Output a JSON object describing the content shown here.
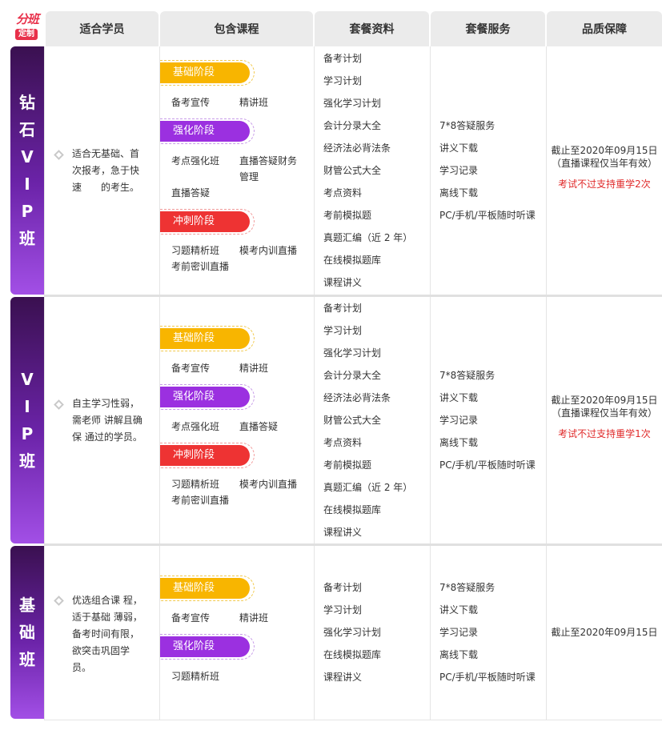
{
  "logo": {
    "top": "分班",
    "box": "定制"
  },
  "headers": [
    "适合学员",
    "包含课程",
    "套餐资料",
    "套餐服务",
    "品质保障"
  ],
  "stages": {
    "basic": "基础阶段",
    "strengthen": "强化阶段",
    "sprint": "冲刺阶段"
  },
  "rows": [
    {
      "label": [
        "钻",
        "石",
        "V",
        "I",
        "P",
        "班"
      ],
      "suitable": [
        "适合无基础、首",
        "次报考，急于快",
        "速　　的考生。"
      ],
      "courses": {
        "basic": [
          "备考宣传",
          "精讲班"
        ],
        "strengthen": [
          "考点强化班",
          "直播答疑财务",
          "管理",
          "直播答疑"
        ],
        "sprint": [
          "习题精析班",
          "模考内训直播",
          "考前密训直播"
        ]
      },
      "materials": [
        "备考计划",
        "学习计划",
        "强化学习计划",
        "会计分录大全",
        "经济法必背法条",
        "财管公式大全",
        "考点资料",
        "考前模拟题",
        "真题汇编（近 2 年）",
        "在线模拟题库",
        "课程讲义"
      ],
      "services": [
        "7*8答疑服务",
        "讲义下载",
        "学习记录",
        "离线下载",
        "PC/手机/平板随时听课"
      ],
      "quality": {
        "line1": "截止至2020年09月15日",
        "line2": "（直播课程仅当年有效）",
        "note": "考试不过支持重学2次"
      }
    },
    {
      "label": [
        "V",
        "I",
        "P",
        "班"
      ],
      "suitable": [
        "自主学习性弱，",
        "需老师 讲解且确",
        "保 通过的学员。"
      ],
      "courses": {
        "basic": [
          "备考宣传",
          "精讲班"
        ],
        "strengthen": [
          "考点强化班",
          "直播答疑"
        ],
        "sprint": [
          "习题精析班",
          "模考内训直播",
          "考前密训直播"
        ]
      },
      "materials": [
        "备考计划",
        "学习计划",
        "强化学习计划",
        "会计分录大全",
        "经济法必背法条",
        "财管公式大全",
        "考点资料",
        "考前模拟题",
        "真题汇编（近 2 年）",
        "在线模拟题库",
        "课程讲义"
      ],
      "services": [
        "7*8答疑服务",
        "讲义下载",
        "学习记录",
        "离线下载",
        "PC/手机/平板随时听课"
      ],
      "quality": {
        "line1": "截止至2020年09月15日",
        "line2": "（直播课程仅当年有效）",
        "note": "考试不过支持重学1次"
      }
    },
    {
      "label": [
        "基",
        "础",
        "班"
      ],
      "suitable": [
        "优选组合课 程，",
        "适于基础 薄弱，",
        "备考时间有限，",
        "欲突击巩固学",
        "员。"
      ],
      "courses": {
        "basic": [
          "备考宣传",
          "精讲班"
        ],
        "strengthen": [
          "习题精析班"
        ]
      },
      "materials": [
        "备考计划",
        "学习计划",
        "强化学习计划",
        "在线模拟题库",
        "课程讲义"
      ],
      "services": [
        "7*8答疑服务",
        "讲义下载",
        "学习记录",
        "离线下载",
        "PC/手机/平板随时听课"
      ],
      "quality": {
        "line1": "截止至2020年09月15日"
      }
    }
  ]
}
